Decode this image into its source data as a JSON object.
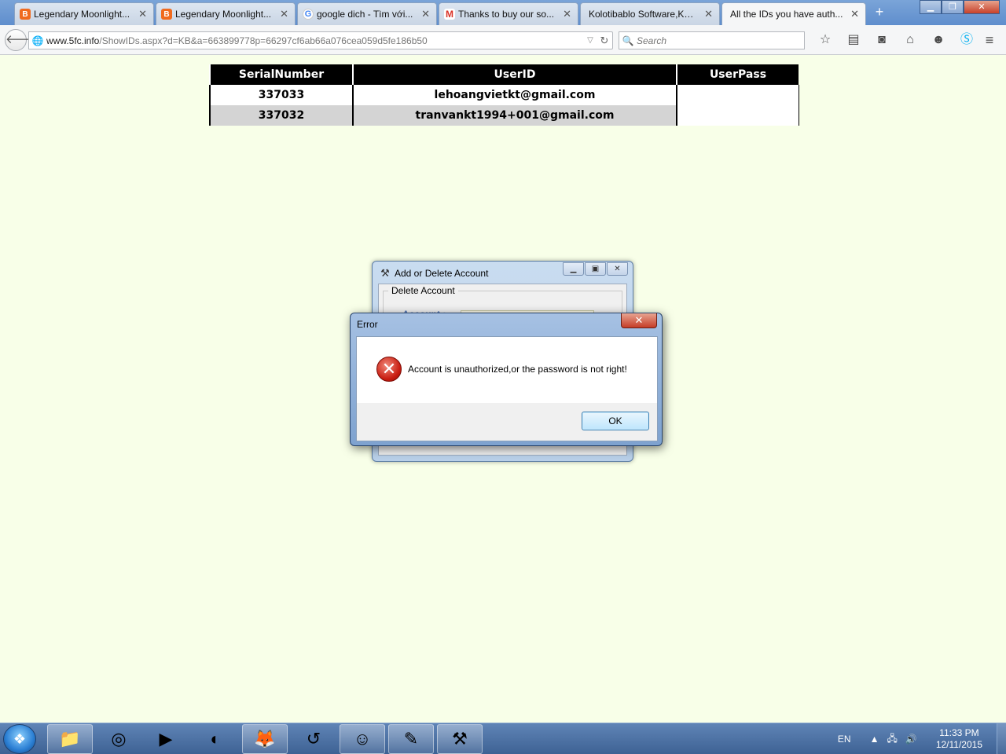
{
  "browser": {
    "tabs": [
      {
        "label": "Legendary Moonlight...",
        "icon": "blogger-icon",
        "active": false
      },
      {
        "label": "Legendary Moonlight...",
        "icon": "blogger-icon",
        "active": false
      },
      {
        "label": "google dich - Tìm với...",
        "icon": "google-icon",
        "active": false
      },
      {
        "label": "Thanks to buy our so...",
        "icon": "gmail-icon",
        "active": false
      },
      {
        "label": "Kolotibablo Software,Kol...",
        "icon": "",
        "active": false
      },
      {
        "label": "All the IDs you have auth...",
        "icon": "",
        "active": true
      }
    ],
    "url_domain": "www.5fc.info",
    "url_path": "/ShowIDs.aspx?d=KB&a=663899778p=66297cf6ab66a076cea059d5fe186b50",
    "search_placeholder": "Search"
  },
  "table": {
    "headers": [
      "SerialNumber",
      "UserID",
      "UserPass"
    ],
    "rows": [
      {
        "serial": "337033",
        "userid": "lehoangvietkt@gmail.com",
        "pass": ""
      },
      {
        "serial": "337032",
        "userid": "tranvankt1994+001@gmail.com",
        "pass": ""
      }
    ]
  },
  "app_window": {
    "title": "Add or Delete Account",
    "group_label": "Delete Account",
    "account_label": "Account :"
  },
  "error_dialog": {
    "title": "Error",
    "message": "Account is unauthorized,or the password is not right!",
    "ok_label": "OK"
  },
  "taskbar": {
    "language": "EN",
    "time": "11:33 PM",
    "date": "12/11/2015"
  },
  "colors": {
    "page_background": "#f8ffe8",
    "header_bg": "#000000",
    "error_red": "#c81b0f"
  }
}
